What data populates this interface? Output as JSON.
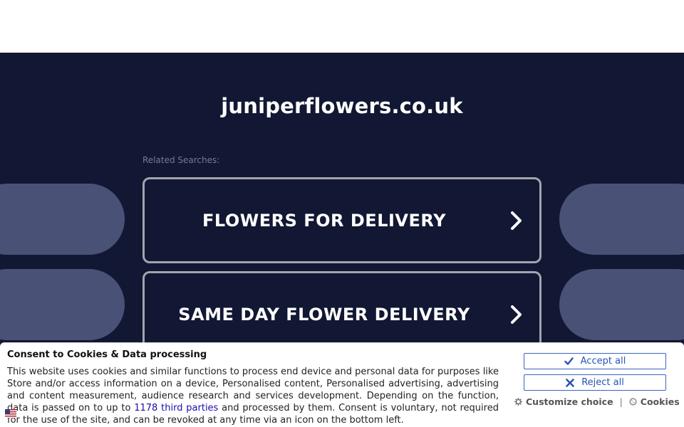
{
  "site": {
    "domain": "juniperflowers.co.uk",
    "related_label": "Related Searches:"
  },
  "searches": [
    {
      "label": "FLOWERS FOR DELIVERY"
    },
    {
      "label": "SAME DAY FLOWER DELIVERY"
    }
  ],
  "consent": {
    "title": "Consent to Cookies & Data processing",
    "text_before_link": "This website uses cookies and similar functions to process end device and personal data for purposes like Store and/or access information on a device, Personalised content, Personalised advertising, advertising and content measurement, audience research and services development. Depending on the function, data is passed on to up to ",
    "link_text": "1178 third parties",
    "text_after_link": " and processed by them. Consent is voluntary, not required for the use of the site, and can be revoked at any time via an icon on the bottom left.",
    "accept_label": "Accept all",
    "reject_label": "Reject all",
    "customize_label": "Customize choice",
    "separator": "|",
    "cookies_label": "Cookies"
  },
  "colors": {
    "background": "#121733",
    "pill": "#4a5177",
    "button_border": "#a3a5ad",
    "consent_accent": "#2a53b6"
  },
  "icons": {
    "search_chevron": "chevron-right-icon",
    "accept": "check-icon",
    "reject": "x-icon",
    "customize": "gear-icon",
    "cookies": "cookie-icon",
    "language": "flag-icon"
  }
}
